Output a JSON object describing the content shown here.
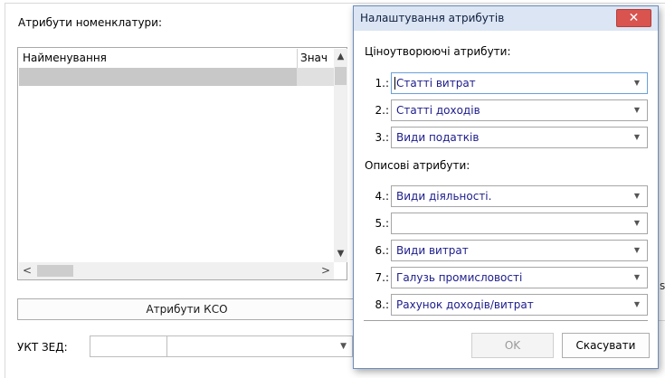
{
  "background": {
    "attributes_label": "Атрибути номенклатури:",
    "table": {
      "columns": [
        "Найменування",
        "Знач"
      ],
      "rows": []
    },
    "kso_button_label": "Атрибути КСО",
    "ukt_label": "УКТ ЗЕД:",
    "ukt_code_value": "",
    "ukt_name_value": "",
    "edge_fragment": "s"
  },
  "dialog": {
    "title": "Налаштування атрибутів",
    "close_glyph": "✕",
    "price_section_label": "Ціноутворюючі атрибути:",
    "descriptive_section_label": "Описові атрибути:",
    "rows": [
      {
        "num": "1.:",
        "value": "Статті витрат"
      },
      {
        "num": "2.:",
        "value": "Статті доходів"
      },
      {
        "num": "3.:",
        "value": "Види податків"
      },
      {
        "num": "4.:",
        "value": "Види діяльності."
      },
      {
        "num": "5.:",
        "value": ""
      },
      {
        "num": "6.:",
        "value": "Види витрат"
      },
      {
        "num": "7.:",
        "value": "Галузь промисловості"
      },
      {
        "num": "8.:",
        "value": "Рахунок доходів/витрат"
      }
    ],
    "ok_label": "OK",
    "cancel_label": "Скасувати"
  },
  "icons": {
    "dropdown": "▼",
    "scroll_up": "▲",
    "scroll_down": "▼",
    "scroll_left": "<",
    "scroll_right": ">"
  },
  "colors": {
    "title_bar": "#dbe5f3",
    "close_button": "#d9534f",
    "select_text": "#1c1c8c",
    "selected_row": "#c8c8c8"
  }
}
